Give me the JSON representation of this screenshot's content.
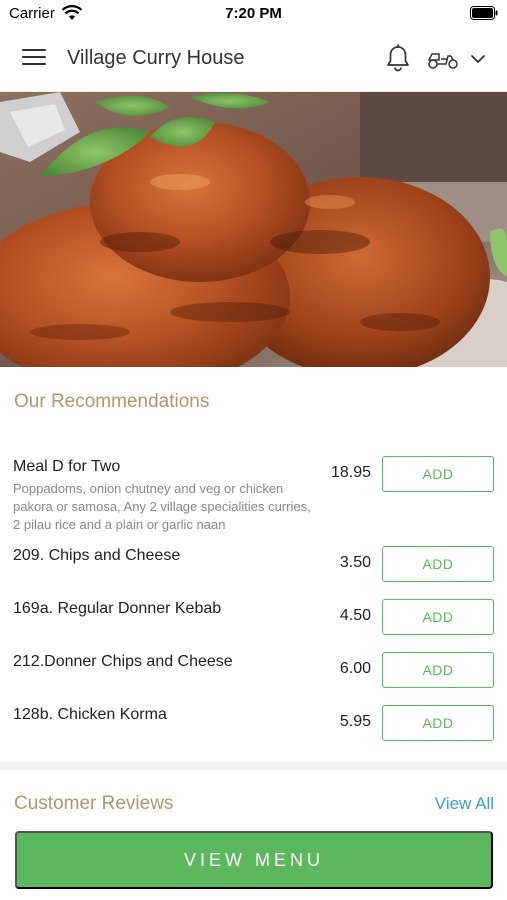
{
  "status_bar": {
    "carrier": "Carrier",
    "time": "7:20 PM"
  },
  "header": {
    "title": "Village Curry House",
    "icons": [
      "menu-icon",
      "bell-icon",
      "scooter-icon",
      "chevron-down-icon"
    ]
  },
  "recommendations": {
    "title": "Our Recommendations",
    "items": [
      {
        "name": "Meal D for Two",
        "description": "Poppadoms, onion chutney and veg or chicken pakora or samosa, Any 2 village specialities curries, 2 pilau rice and a plain or garlic naan",
        "price": "18.95",
        "button": "ADD"
      },
      {
        "name": "209. Chips and Cheese",
        "price": "3.50",
        "button": "ADD"
      },
      {
        "name": "169a. Regular Donner Kebab",
        "price": "4.50",
        "button": "ADD"
      },
      {
        "name": "212.Donner Chips and Cheese",
        "price": "6.00",
        "button": "ADD"
      },
      {
        "name": "128b. Chicken Korma",
        "price": "5.95",
        "button": "ADD"
      }
    ]
  },
  "reviews": {
    "title": "Customer Reviews",
    "view_all": "View All"
  },
  "footer": {
    "view_menu": "VIEW MENU"
  },
  "colors": {
    "accent_green": "#5cb85c",
    "section_title": "#a8996e",
    "link_blue": "#3a9ecf"
  }
}
